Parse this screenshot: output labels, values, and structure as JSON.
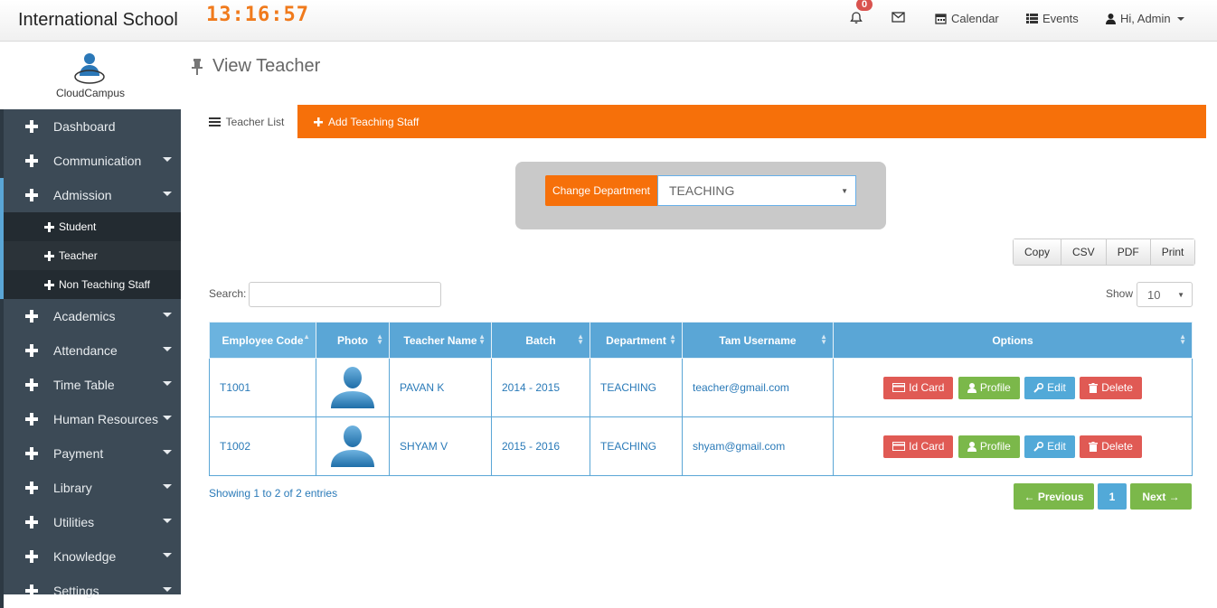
{
  "header": {
    "school_name": "International School",
    "clock": "13:16:57",
    "notification_count": "0",
    "calendar_label": "Calendar",
    "events_label": "Events",
    "user_label": "Hi, Admin"
  },
  "brand": {
    "name": "CloudCampus"
  },
  "sidebar": {
    "items": [
      {
        "label": "Dashboard"
      },
      {
        "label": "Communication"
      },
      {
        "label": "Admission"
      },
      {
        "label": "Academics"
      },
      {
        "label": "Attendance"
      },
      {
        "label": "Time Table"
      },
      {
        "label": "Human Resources"
      },
      {
        "label": "Payment"
      },
      {
        "label": "Library"
      },
      {
        "label": "Utilities"
      },
      {
        "label": "Knowledge"
      },
      {
        "label": "Settings"
      }
    ],
    "admission_sub": [
      {
        "label": "Student"
      },
      {
        "label": "Teacher"
      },
      {
        "label": "Non Teaching Staff"
      }
    ]
  },
  "page": {
    "title": "View Teacher"
  },
  "tabs": {
    "list_label": "Teacher List",
    "add_label": "Add Teaching Staff"
  },
  "department": {
    "label": "Change Department",
    "selected": "TEACHING"
  },
  "export": {
    "copy": "Copy",
    "csv": "CSV",
    "pdf": "PDF",
    "print": "Print"
  },
  "search": {
    "label": "Search:",
    "value": ""
  },
  "show": {
    "label": "Show",
    "value": "10"
  },
  "table": {
    "headers": [
      "Employee Code",
      "Photo",
      "Teacher Name",
      "Batch",
      "Department",
      "Tam Username",
      "Options"
    ],
    "rows": [
      {
        "code": "T1001",
        "name": "PAVAN K",
        "batch": "2014 - 2015",
        "department": "TEACHING",
        "username": "teacher@gmail.com"
      },
      {
        "code": "T1002",
        "name": "SHYAM V",
        "batch": "2015 - 2016",
        "department": "TEACHING",
        "username": "shyam@gmail.com"
      }
    ],
    "options": {
      "id_card": "Id Card",
      "profile": "Profile",
      "edit": "Edit",
      "delete": "Delete"
    }
  },
  "pagination": {
    "info": "Showing 1 to 2 of 2 entries",
    "previous": "← Previous",
    "current": "1",
    "next": "Next →"
  },
  "colors": {
    "accent": "#f6700a",
    "table_header": "#5aa6d6",
    "sidebar": "#3c4a56",
    "danger": "#e05a54",
    "success": "#7bb84a",
    "info": "#52a9d8"
  }
}
